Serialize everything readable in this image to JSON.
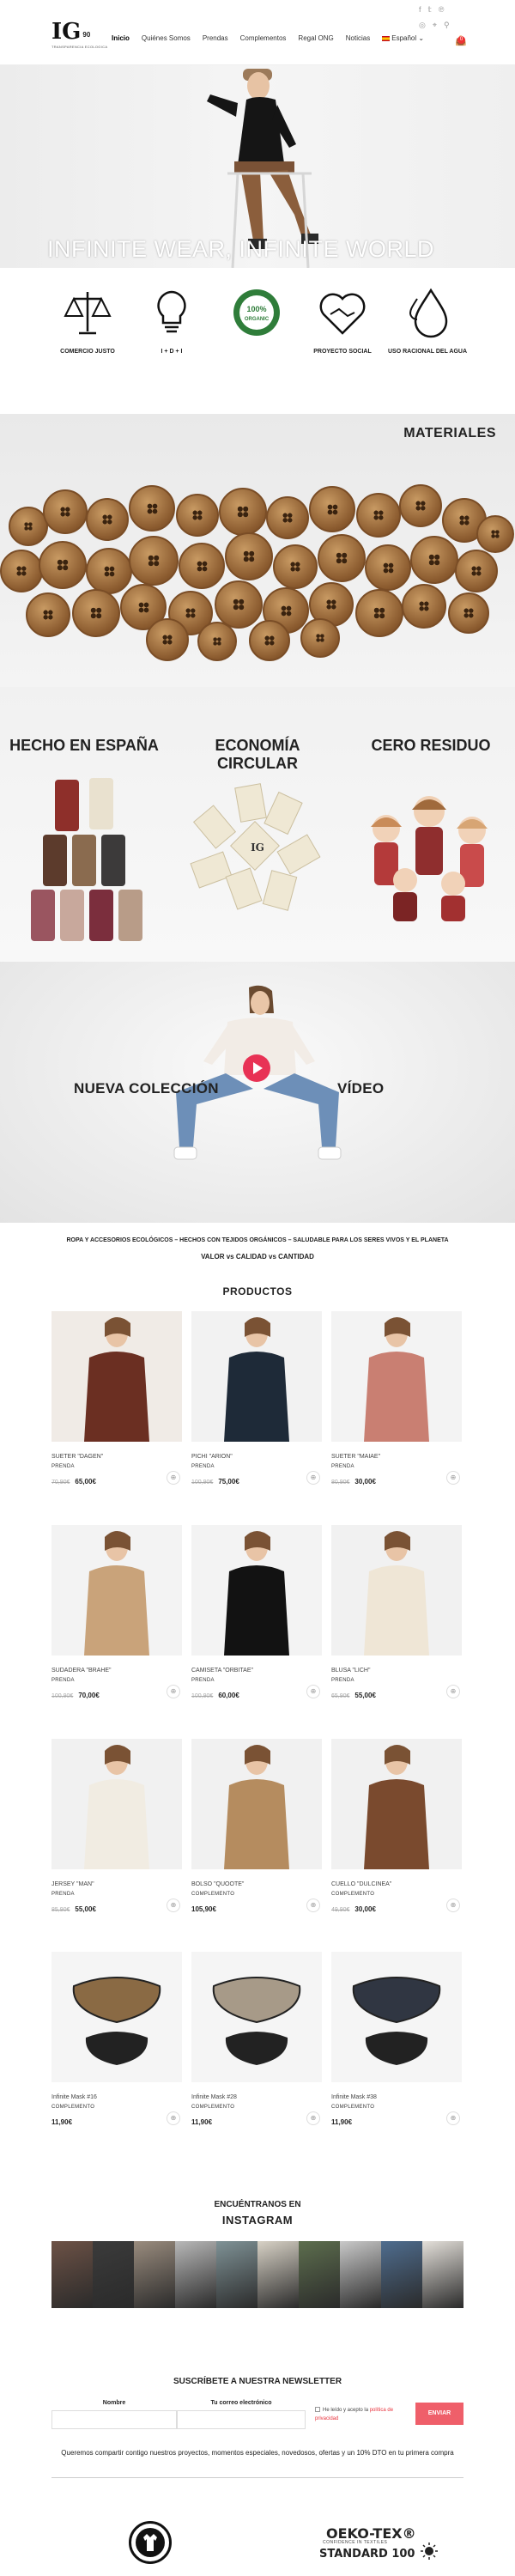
{
  "header": {
    "logo_mark": "IG",
    "logo_suffix": "90",
    "logo_tagline": "TRANSPARENCIA ECOLOGICA",
    "nav": [
      "Inicio",
      "Quiénes Somos",
      "Prendas",
      "Complementos",
      "Regal ONG",
      "Noticias"
    ],
    "language": "Español",
    "cart_count": "0",
    "social_icons": [
      "facebook-icon",
      "twitter-icon",
      "pinterest-icon",
      "instagram-icon",
      "location-icon",
      "search-icon"
    ]
  },
  "hero": {
    "title": "INFINITE WEAR, INFINITE WORLD"
  },
  "values": [
    {
      "label": "COMERCIO JUSTO",
      "icon": "scales-icon"
    },
    {
      "label": "I + D + I",
      "icon": "lightbulb-icon"
    },
    {
      "label": "100% ORGANIC",
      "icon": "organic-seal-icon"
    },
    {
      "label": "PROYECTO SOCIAL",
      "icon": "handshake-heart-icon"
    },
    {
      "label": "USO RACIONAL DEL AGUA",
      "icon": "water-drops-icon"
    }
  ],
  "materials": {
    "title": "MATERIALES"
  },
  "features": [
    {
      "title": "HECHO EN ESPAÑA"
    },
    {
      "title": "ECONOMÍA CIRCULAR"
    },
    {
      "title": "CERO RESIDUO"
    }
  ],
  "video": {
    "left_text": "NUEVA COLECCIÓN",
    "right_text": "VÍDEO"
  },
  "tagline": {
    "line1": "ROPA Y ACCESORIOS ECOLÓGICOS – HECHOS CON TEJIDOS ORGÁNICOS – SALUDABLE PARA LOS SERES VIVOS Y EL PLANETA",
    "line2": "VALOR vs CALIDAD vs CANTIDAD"
  },
  "products": {
    "title": "PRODUCTOS",
    "items": [
      {
        "name": "SUETER \"DAGEN\"",
        "category": "PRENDA",
        "old_price": "70,90€",
        "price": "65,00€"
      },
      {
        "name": "PICHI \"ARION\"",
        "category": "PRENDA",
        "old_price": "100,90€",
        "price": "75,00€"
      },
      {
        "name": "SUETER \"MAIAE\"",
        "category": "PRENDA",
        "old_price": "80,90€",
        "price": "30,00€"
      },
      {
        "name": "SUDADERA \"BRAHE\"",
        "category": "PRENDA",
        "old_price": "100,90€",
        "price": "70,00€"
      },
      {
        "name": "CAMISETA \"ORBITAE\"",
        "category": "PRENDA",
        "old_price": "100,90€",
        "price": "60,00€"
      },
      {
        "name": "BLUSA \"LICH\"",
        "category": "PRENDA",
        "old_price": "65,90€",
        "price": "55,00€"
      },
      {
        "name": "JERSEY \"MAN\"",
        "category": "PRENDA",
        "old_price": "85,90€",
        "price": "55,00€"
      },
      {
        "name": "BOLSO \"QUOOTE\"",
        "category": "COMPLEMENTO",
        "old_price": "",
        "price": "105,90€"
      },
      {
        "name": "CUELLO \"DULCINEA\"",
        "category": "COMPLEMENTO",
        "old_price": "49,90€",
        "price": "30,00€"
      },
      {
        "name": "Infinite Mask #16",
        "category": "COMPLEMENTO",
        "old_price": "",
        "price": "11,90€"
      },
      {
        "name": "Infinite Mask #28",
        "category": "COMPLEMENTO",
        "old_price": "",
        "price": "11,90€"
      },
      {
        "name": "Infinite Mask #38",
        "category": "COMPLEMENTO",
        "old_price": "",
        "price": "11,90€"
      }
    ]
  },
  "instagram": {
    "title_line1": "ENCUÉNTRANOS EN",
    "title_line2": "INSTAGRAM"
  },
  "newsletter": {
    "title": "SUSCRÍBETE A NUESTRA NEWSLETTER",
    "name_label": "Nombre",
    "email_label": "Tu correo electrónico",
    "privacy_prefix": "He leído y acepto la",
    "privacy_link": "política de privacidad",
    "button": "ENVIAR",
    "description": "Queremos compartir contigo nuestros proyectos, momentos especiales, novedosos, ofertas y un 10% DTO en tu primera compra"
  },
  "certifications": {
    "oeko_line1": "OEKO-TEX®",
    "oeko_line2": "CONFIDENCE IN TEXTILES",
    "oeko_line3": "STANDARD 100"
  },
  "colors": {
    "accent": "#e83255",
    "send_button": "#ef5f6a",
    "wood": "#a8733f"
  }
}
